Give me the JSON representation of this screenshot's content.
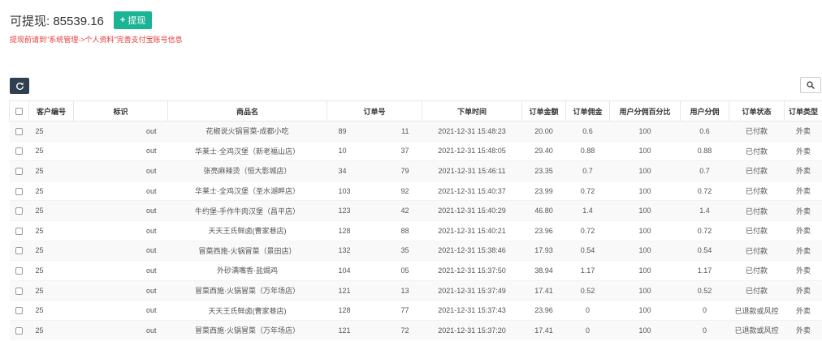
{
  "header": {
    "balance_label": "可提现: 85539.16",
    "withdraw_label": "提现",
    "withdraw_icon": "plus-icon",
    "notice": "提现前请到\"系统管理->个人资料\"完善支付宝账号信息"
  },
  "toolbar": {
    "refresh_icon": "refresh-icon",
    "search_icon": "search-icon"
  },
  "colors": {
    "accent": "#1ab394",
    "notice": "#e63a3a",
    "refresh_bg": "#2f4050"
  },
  "table": {
    "columns": [
      "客户编号",
      "标识",
      "商品名",
      "订单号",
      "下单时间",
      "订单金额",
      "订单佣金",
      "用户分佣百分比",
      "用户分佣",
      "订单状态",
      "订单类型"
    ],
    "rows": [
      {
        "customer": "25",
        "mark": "out",
        "product": "花椒说火锅冒菜-成都小吃",
        "order_a": "89",
        "order_b": "11",
        "time": "2021-12-31 15:48:23",
        "amount": "20.00",
        "commission": "0.6",
        "percent": "100",
        "user_share": "0.6",
        "status": "已付款",
        "type": "外卖"
      },
      {
        "customer": "25",
        "mark": "out",
        "product": "华莱士·全鸡汉堡（新老福山店）",
        "order_a": "10",
        "order_b": "37",
        "time": "2021-12-31 15:48:05",
        "amount": "29.40",
        "commission": "0.88",
        "percent": "100",
        "user_share": "0.88",
        "status": "已付款",
        "type": "外卖"
      },
      {
        "customer": "25",
        "mark": "out",
        "product": "张亮麻辣烫（恒大影城店）",
        "order_a": "34",
        "order_b": "79",
        "time": "2021-12-31 15:46:11",
        "amount": "23.35",
        "commission": "0.7",
        "percent": "100",
        "user_share": "0.7",
        "status": "已付款",
        "type": "外卖"
      },
      {
        "customer": "25",
        "mark": "out",
        "product": "华莱士·全鸡汉堡（圣水湖畔店）",
        "order_a": "103",
        "order_b": "92",
        "time": "2021-12-31 15:40:37",
        "amount": "23.99",
        "commission": "0.72",
        "percent": "100",
        "user_share": "0.72",
        "status": "已付款",
        "type": "外卖"
      },
      {
        "customer": "25",
        "mark": "out",
        "product": "牛约堡-手作牛肉汉堡（昌平店）",
        "order_a": "123",
        "order_b": "42",
        "time": "2021-12-31 15:40:29",
        "amount": "46.80",
        "commission": "1.4",
        "percent": "100",
        "user_share": "1.4",
        "status": "已付款",
        "type": "外卖"
      },
      {
        "customer": "25",
        "mark": "out",
        "product": "天天王氏鲜卤(曹家巷店)",
        "order_a": "128",
        "order_b": "88",
        "time": "2021-12-31 15:40:21",
        "amount": "23.96",
        "commission": "0.72",
        "percent": "100",
        "user_share": "0.72",
        "status": "已付款",
        "type": "外卖"
      },
      {
        "customer": "25",
        "mark": "out",
        "product": "冒菜西施·火锅冒菜（景田店）",
        "order_a": "132",
        "order_b": "35",
        "time": "2021-12-31 15:38:46",
        "amount": "17.93",
        "commission": "0.54",
        "percent": "100",
        "user_share": "0.54",
        "status": "已付款",
        "type": "外卖"
      },
      {
        "customer": "25",
        "mark": "out",
        "product": "外砂满嘴香·盐焗鸡",
        "order_a": "104",
        "order_b": "05",
        "time": "2021-12-31 15:37:50",
        "amount": "38.94",
        "commission": "1.17",
        "percent": "100",
        "user_share": "1.17",
        "status": "已付款",
        "type": "外卖"
      },
      {
        "customer": "25",
        "mark": "out",
        "product": "冒菜西施·火锅冒菜（万年场店）",
        "order_a": "121",
        "order_b": "13",
        "time": "2021-12-31 15:37:49",
        "amount": "17.41",
        "commission": "0.52",
        "percent": "100",
        "user_share": "0.52",
        "status": "已付款",
        "type": "外卖"
      },
      {
        "customer": "25",
        "mark": "out",
        "product": "天天王氏鲜卤(曹家巷店)",
        "order_a": "128",
        "order_b": "77",
        "time": "2021-12-31 15:37:43",
        "amount": "23.96",
        "commission": "0",
        "percent": "100",
        "user_share": "0",
        "status": "已退款或风控",
        "type": "外卖"
      },
      {
        "customer": "25",
        "mark": "out",
        "product": "冒菜西施·火锅冒菜（万年场店）",
        "order_a": "121",
        "order_b": "72",
        "time": "2021-12-31 15:37:20",
        "amount": "17.41",
        "commission": "0",
        "percent": "100",
        "user_share": "0",
        "status": "已退款或风控",
        "type": "外卖"
      }
    ]
  }
}
